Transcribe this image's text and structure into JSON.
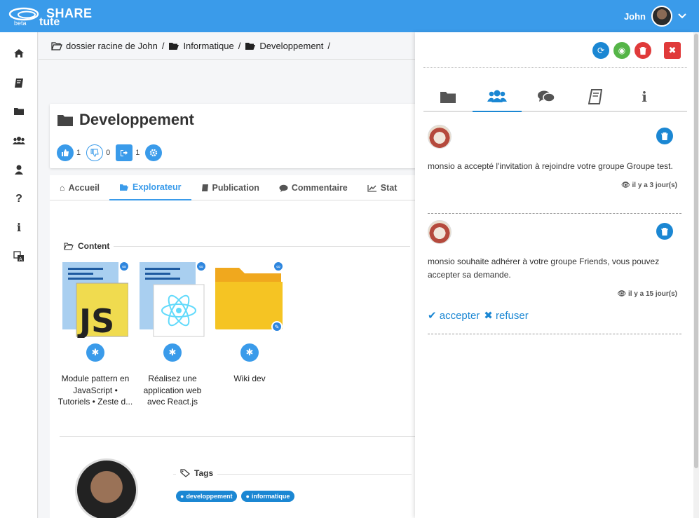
{
  "app": {
    "logo_top": "SHARE",
    "logo_bottom": "tute",
    "logo_badge": "beta"
  },
  "user": {
    "name": "John"
  },
  "sidebar": {
    "items": [
      {
        "icon": "home-icon",
        "glyph": "⌂"
      },
      {
        "icon": "book-icon",
        "glyph": "▤"
      },
      {
        "icon": "folder-icon",
        "glyph": "▬"
      },
      {
        "icon": "users-icon",
        "glyph": "⚇"
      },
      {
        "icon": "user-icon",
        "glyph": "●"
      },
      {
        "icon": "help-icon",
        "glyph": "?"
      },
      {
        "icon": "info-icon",
        "glyph": "i"
      },
      {
        "icon": "translate-icon",
        "glyph": "文"
      }
    ]
  },
  "breadcrumb": {
    "items": [
      "dossier racine de John",
      "Informatique",
      "Developpement"
    ],
    "separator": "/"
  },
  "folder": {
    "title": "Developpement",
    "likes": "1",
    "dislikes": "0",
    "shares": "1"
  },
  "tabs": [
    {
      "label": "Accueil"
    },
    {
      "label": "Explorateur"
    },
    {
      "label": "Publication"
    },
    {
      "label": "Commentaire"
    },
    {
      "label": "Stat"
    }
  ],
  "content": {
    "legend": "Content",
    "items": [
      {
        "title": "Module pattern en JavaScript • Tutoriels • Zeste d..."
      },
      {
        "title": "Réalisez une application web avec React.js"
      },
      {
        "title": "Wiki dev"
      }
    ]
  },
  "tags": {
    "legend": "Tags",
    "items": [
      "developpement",
      "informatique"
    ]
  },
  "panel": {
    "notifications": [
      {
        "text": "monsio a accepté l'invitation à rejoindre votre groupe Groupe test.",
        "time": "il y a 3 jour(s)"
      },
      {
        "text": "monsio souhaite adhérer à votre groupe Friends, vous pouvez accepter sa demande.",
        "time": "il y a 15 jour(s)",
        "accept": "accepter",
        "refuse": "refuser"
      }
    ]
  },
  "colors": {
    "accent": "#3a9bea",
    "danger": "#e03a3a",
    "success": "#55b548"
  }
}
